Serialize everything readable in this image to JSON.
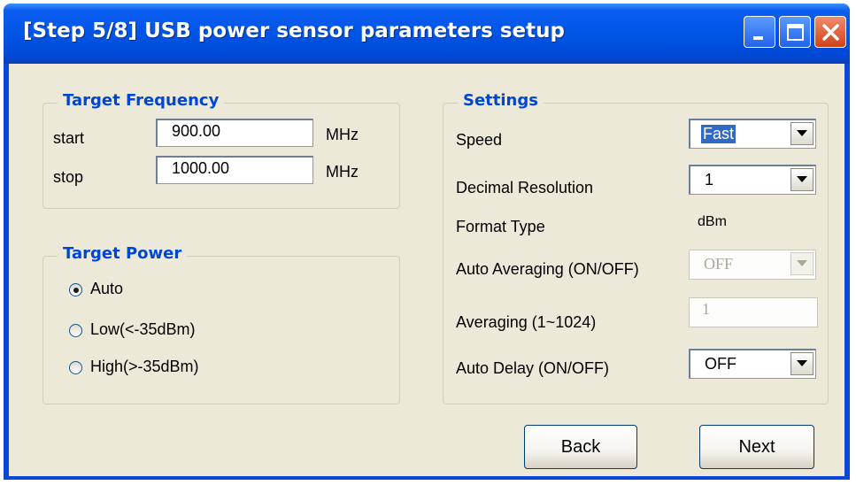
{
  "window": {
    "title": "[Step 5/8] USB power sensor parameters setup",
    "controls": {
      "minimize_icon": "minimize-icon",
      "maximize_icon": "maximize-icon",
      "close_icon": "close-icon"
    }
  },
  "target_frequency": {
    "legend": "Target Frequency",
    "start_label": "start",
    "start_value": "900.00",
    "start_unit": "MHz",
    "stop_label": "stop",
    "stop_value": "1000.00",
    "stop_unit": "MHz"
  },
  "target_power": {
    "legend": "Target Power",
    "options": [
      {
        "label": "Auto",
        "checked": true
      },
      {
        "label": "Low(<-35dBm)",
        "checked": false
      },
      {
        "label": "High(>-35dBm)",
        "checked": false
      }
    ]
  },
  "settings": {
    "legend": "Settings",
    "speed_label": "Speed",
    "speed_value": "Fast",
    "decimal_label": "Decimal  Resolution",
    "decimal_value": "1",
    "format_label": "Format Type",
    "format_value": "dBm",
    "auto_avg_label": "Auto Averaging  (ON/OFF)",
    "auto_avg_value": "OFF",
    "averaging_label": "Averaging  (1~1024)",
    "averaging_value": "1",
    "auto_delay_label": "Auto Delay (ON/OFF)",
    "auto_delay_value": "OFF"
  },
  "buttons": {
    "back": "Back",
    "next": "Next"
  },
  "colors": {
    "titlebar": "#0055e5",
    "legend": "#0046d5",
    "client": "#ece9d8",
    "close": "#d24219"
  }
}
